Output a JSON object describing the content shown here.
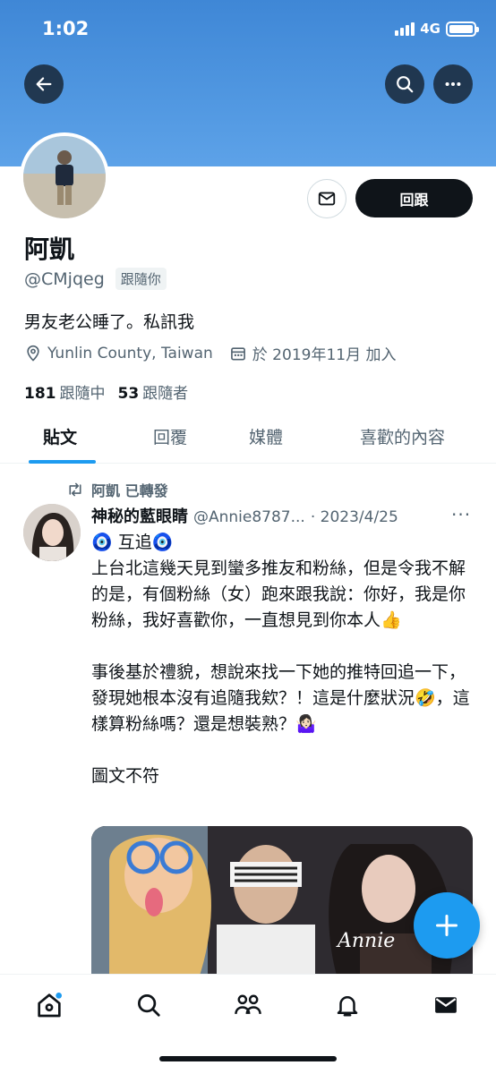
{
  "status_bar": {
    "time": "1:02",
    "network": "4G"
  },
  "profile": {
    "name": "阿凱",
    "handle": "@CMjqeg",
    "follows_you": "跟隨你",
    "bio": "男友老公睡了。私訊我",
    "location": "Yunlin County, Taiwan",
    "joined": "於 2019年11月 加入",
    "following_count": "181",
    "following_label": "跟隨中",
    "followers_count": "53",
    "followers_label": "跟隨者",
    "follow_back_label": "回跟"
  },
  "tabs": [
    {
      "label": "貼文",
      "active": true
    },
    {
      "label": "回覆",
      "active": false
    },
    {
      "label": "媒體",
      "active": false
    },
    {
      "label": "喜歡的內容",
      "active": false
    }
  ],
  "post": {
    "retweet_label": "阿凱 已轉發",
    "author_name": "神秘的藍眼睛",
    "author_handle": "@Annie8787...",
    "date": "· 2023/4/25",
    "more": "···",
    "lines": [
      "🧿 互追🧿",
      "上台北這幾天見到蠻多推友和粉絲，但是令我不解的是，有個粉絲（女）跑來跟我說：你好，我是你粉絲，我好喜歡你，一直想見到你本人👍",
      "",
      "事後基於禮貌，想說來找一下她的推特回追一下，發現她根本沒有追隨我欸？！這是什麼狀況🤣，這樣算粉絲嗎？還是想裝熟？🤷🏻‍♀️",
      "",
      "圖文不符"
    ],
    "image_watermark": "Annie"
  },
  "colors": {
    "accent": "#1d9bf0",
    "banner": "#4a90dc",
    "text": "#0f1419",
    "muted": "#536471"
  },
  "icons": [
    "back-arrow-icon",
    "search-icon",
    "more-icon",
    "mail-icon",
    "location-pin-icon",
    "calendar-icon",
    "retweet-icon",
    "plus-icon",
    "home-icon",
    "explore-icon",
    "communities-icon",
    "notifications-icon",
    "messages-icon"
  ]
}
